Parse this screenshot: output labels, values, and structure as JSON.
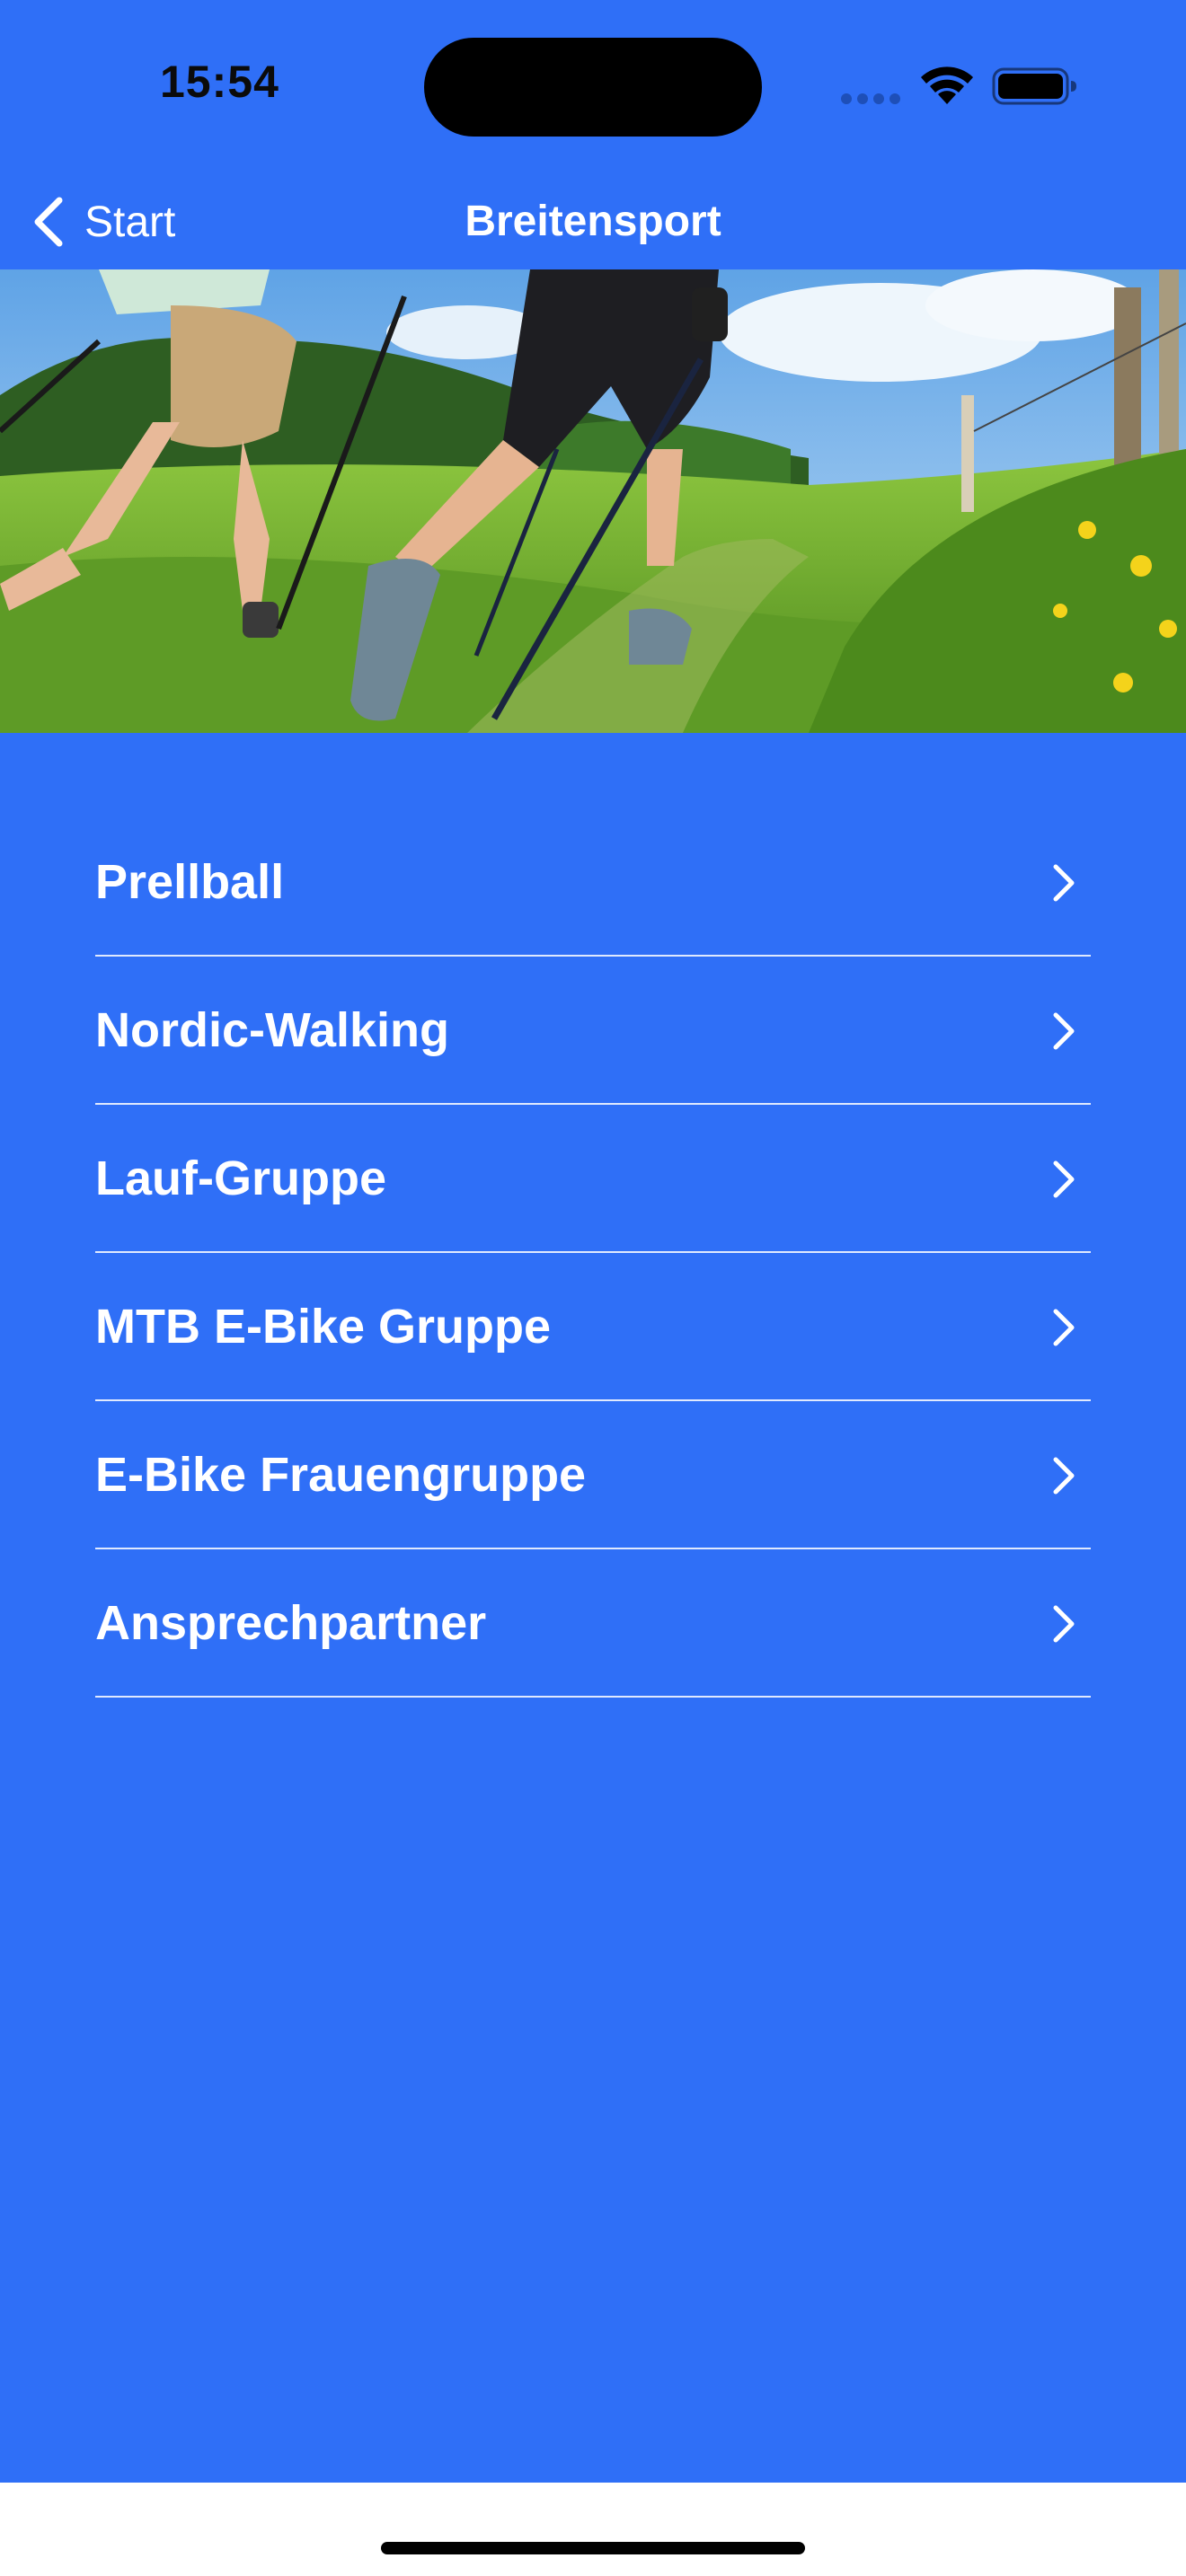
{
  "status_bar": {
    "time": "15:54",
    "icons": [
      "signal-dots-icon",
      "wifi-icon",
      "battery-icon"
    ]
  },
  "nav": {
    "back_label": "Start",
    "title": "Breitensport"
  },
  "header_image": {
    "icon": "nordic-walking-photo"
  },
  "list": {
    "items": [
      {
        "label": "Prellball"
      },
      {
        "label": "Nordic-Walking"
      },
      {
        "label": "Lauf-Gruppe"
      },
      {
        "label": "MTB E-Bike Gruppe"
      },
      {
        "label": "E-Bike Frauengruppe"
      },
      {
        "label": "Ansprechpartner"
      }
    ]
  },
  "colors": {
    "background": "#2F6FF7",
    "text": "#FFFFFF",
    "separator": "#FFFFFF",
    "bottom_bar": "#FFFFFF"
  }
}
